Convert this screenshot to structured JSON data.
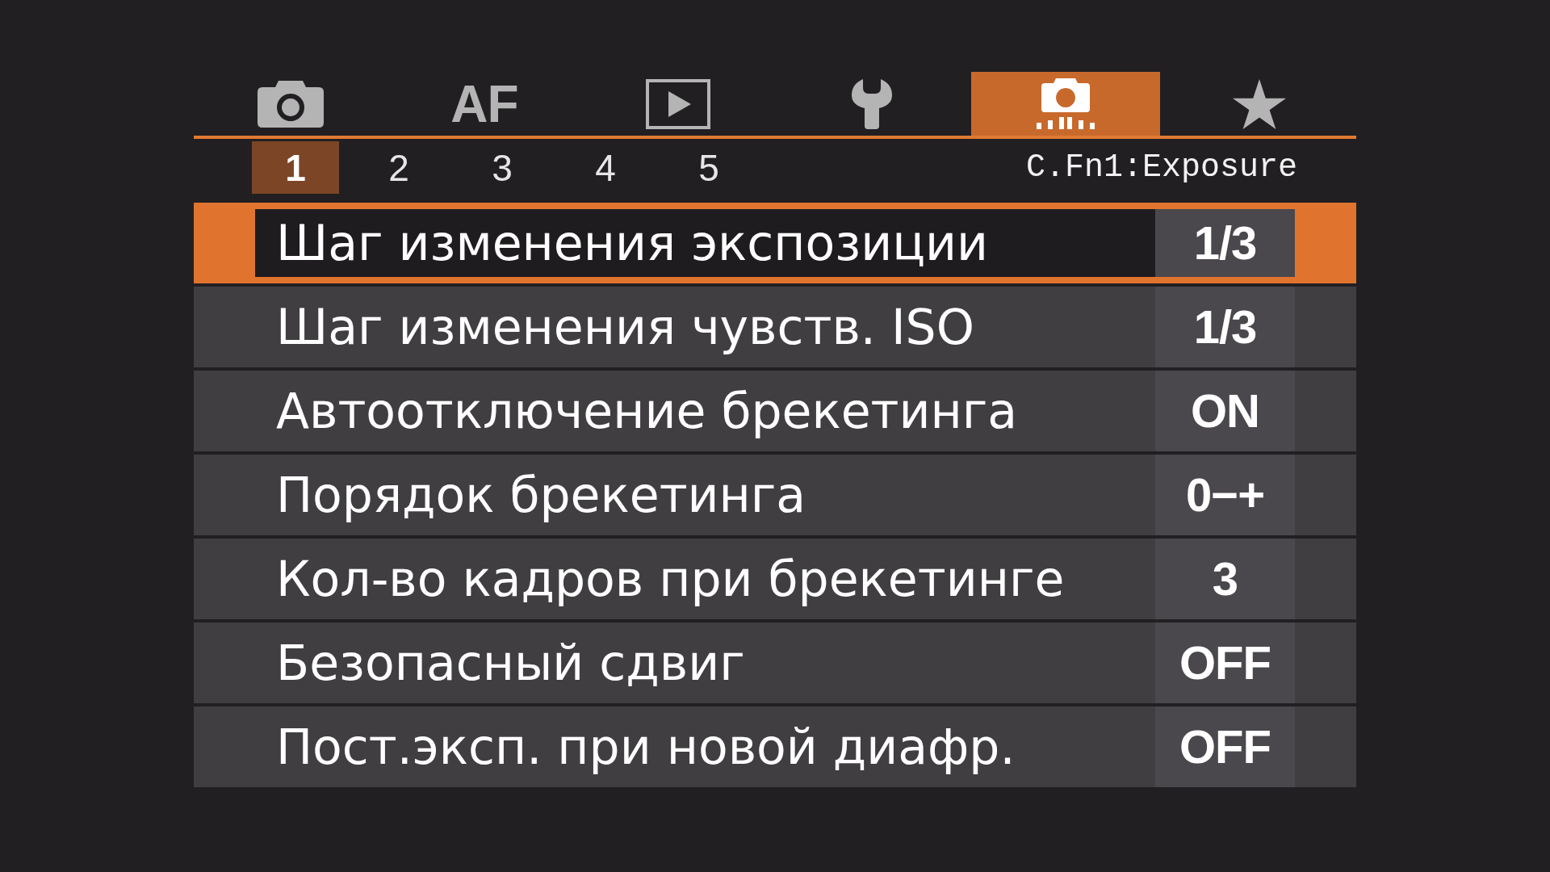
{
  "tabs": [
    {
      "kind": "camera",
      "selected": false
    },
    {
      "kind": "text",
      "label": "AF",
      "selected": false
    },
    {
      "kind": "playback",
      "selected": false
    },
    {
      "kind": "wrench",
      "selected": false
    },
    {
      "kind": "custom",
      "selected": true
    },
    {
      "kind": "star",
      "selected": false
    }
  ],
  "pages": [
    {
      "label": "1",
      "selected": true
    },
    {
      "label": "2",
      "selected": false
    },
    {
      "label": "3",
      "selected": false
    },
    {
      "label": "4",
      "selected": false
    },
    {
      "label": "5",
      "selected": false
    }
  ],
  "page_title": "C.Fn1:Exposure",
  "items": [
    {
      "label": "Шаг изменения экспозиции",
      "value": "1/3",
      "selected": true
    },
    {
      "label": "Шаг изменения чувств. ISO",
      "value": "1/3",
      "selected": false
    },
    {
      "label": "Автоотключение брекетинга",
      "value": "ON",
      "selected": false
    },
    {
      "label": "Порядок брекетинга",
      "value": "0−+",
      "selected": false
    },
    {
      "label": "Кол-во кадров при брекетинге",
      "value": "3",
      "selected": false
    },
    {
      "label": "Безопасный сдвиг",
      "value": "OFF",
      "selected": false
    },
    {
      "label": "Пост.эксп. при новой диафр.",
      "value": "OFF",
      "selected": false
    }
  ]
}
